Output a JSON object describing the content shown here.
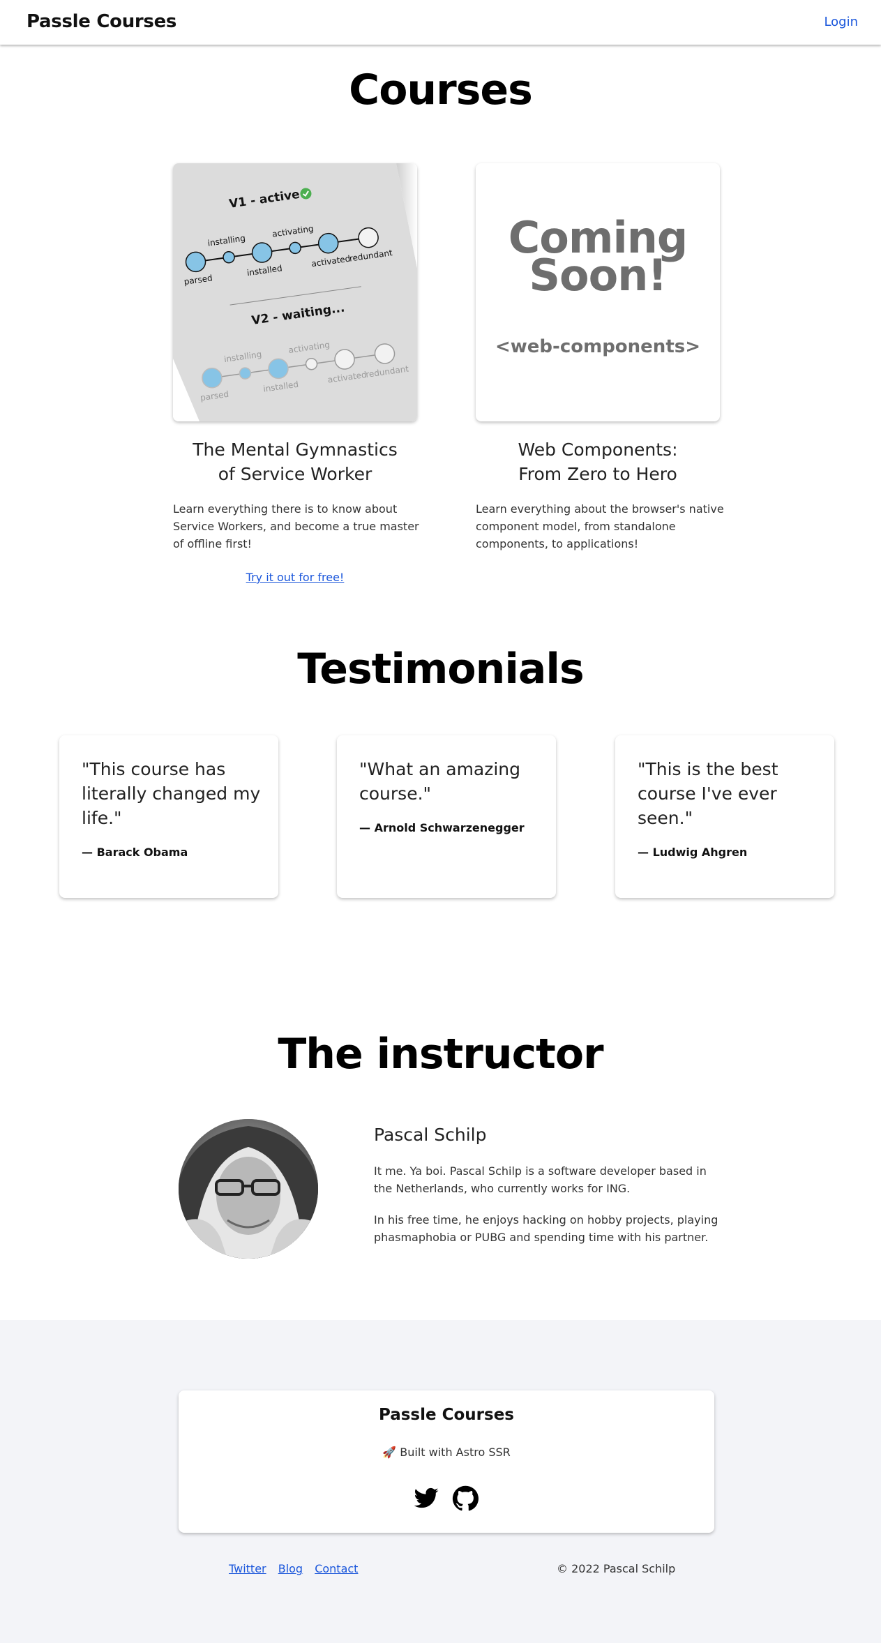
{
  "nav": {
    "brand": "Passle Courses",
    "login": "Login"
  },
  "courses": {
    "heading": "Courses",
    "items": [
      {
        "image": {
          "v1_title": "V1 - active",
          "v2_title": "V2 - waiting...",
          "states": [
            "parsed",
            "installing",
            "installed",
            "activating",
            "activated",
            "redundant"
          ]
        },
        "title_line1": "The Mental Gymnastics",
        "title_line2": "of Service Worker",
        "description": "Learn everything there is to know about Service Workers, and become a true master of offline first!",
        "cta": "Try it out for free!"
      },
      {
        "image": {
          "coming_line1": "Coming",
          "coming_line2": "Soon!",
          "tag": "<web-components>"
        },
        "title_line1": "Web Components:",
        "title_line2": "From Zero to Hero",
        "description": "Learn everything about the browser's native component model, from standalone components, to applications!"
      }
    ]
  },
  "testimonials": {
    "heading": "Testimonials",
    "items": [
      {
        "quote": "\"This course has literally changed my life.\"",
        "author": "— Barack Obama"
      },
      {
        "quote": "\"What an amazing course.\"",
        "author": "— Arnold Schwarzenegger"
      },
      {
        "quote": "\"This is the best course I've ever seen.\"",
        "author": "— Ludwig Ahgren"
      }
    ]
  },
  "instructor": {
    "heading": "The instructor",
    "name": "Pascal Schilp",
    "bio1": "It me. Ya boi. Pascal Schilp is a software developer based in the Netherlands, who currently works for ING.",
    "bio2": "In his free time, he enjoys hacking on hobby projects, playing phasmaphobia or PUBG and spending time with his partner."
  },
  "footer": {
    "brand": "Passle Courses",
    "built_icon": "rocket-icon",
    "built": "Built with Astro SSR",
    "social": [
      "twitter-icon",
      "github-icon"
    ],
    "links": [
      "Twitter",
      "Blog",
      "Contact"
    ],
    "copyright": "© 2022 Pascal Schilp"
  },
  "colors": {
    "link": "#1a56db",
    "footer_bg": "#f3f4f8",
    "sw_blue": "#87c4e6",
    "coming_gray": "#6e6e6e"
  }
}
